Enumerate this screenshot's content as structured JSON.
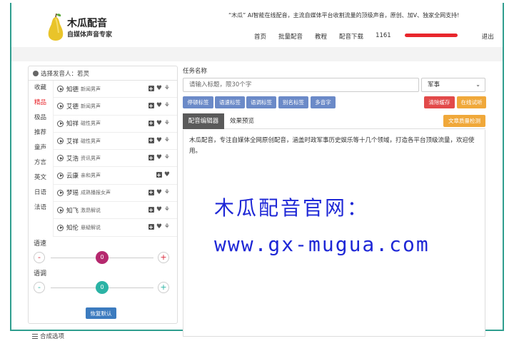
{
  "header": {
    "brand": "木瓜配音",
    "brand_sub": "自媒体声音专家",
    "slogan": "“木瓜” AI智能在线配音，主流自媒体平台收割流量的顶级声音，原创、加V、独家全网支持!",
    "nav": [
      "首页",
      "批量配音",
      "教程",
      "配音下载"
    ],
    "user_prefix": "1161",
    "logout": "退出"
  },
  "voice_panel": {
    "header": "选择发音人：若灵",
    "categories": [
      "收藏",
      "精品",
      "极品",
      "推荐",
      "童声",
      "方言",
      "英文",
      "日语",
      "法语"
    ],
    "active_category": "精品",
    "voices": [
      {
        "name": "知德",
        "desc": "新闻男声",
        "sprout": true
      },
      {
        "name": "艾德",
        "desc": "新闻男声",
        "sprout": true
      },
      {
        "name": "知祥",
        "desc": "磁性男声",
        "sprout": true
      },
      {
        "name": "艾祥",
        "desc": "磁性男声",
        "sprout": true
      },
      {
        "name": "艾浩",
        "desc": "资讯男声",
        "sprout": true
      },
      {
        "name": "云康",
        "desc": "亲和男声",
        "sprout": false
      },
      {
        "name": "梦瑶",
        "desc": "成熟播报女声",
        "sprout": true
      },
      {
        "name": "知飞",
        "desc": "激昂解说",
        "sprout": true
      },
      {
        "name": "知伦",
        "desc": "悬疑解说",
        "sprout": true
      }
    ],
    "speed": {
      "label": "语速",
      "minus": "-",
      "plus": "+",
      "value": "0",
      "color": "#b5286e"
    },
    "pitch": {
      "label": "语调",
      "minus": "-",
      "plus": "+",
      "value": "0",
      "color": "#2bb3a5"
    },
    "reset_label": "恢复默认",
    "combo_options": "合成选项"
  },
  "task": {
    "label": "任务名称",
    "title_placeholder": "请输入标题，限30个字",
    "genre": "军事"
  },
  "tag_buttons": [
    "停顿标签",
    "语速标签",
    "语调标签",
    "别名标签",
    "多音字"
  ],
  "actions": {
    "clear": "清除缓存",
    "listen": "在线试听",
    "quality": "文章质量检测"
  },
  "tabs": {
    "editor": "配音编辑器",
    "preview": "效果预览"
  },
  "editor": {
    "content": "木瓜配音，专注自媒体全网原创配音，涵盖时政军事历史娱乐等十几个领域，打造各平台顶级流量，欢迎使用。",
    "watermark_line1": "木瓜配音官网：",
    "watermark_line2": "www.gx-mugua.com"
  },
  "colors": {
    "tag_blue": "#6b8ac8",
    "clear_red": "#e24a4a",
    "listen_orange": "#f0a83a",
    "quality_orange": "#f0a83a",
    "reset_blue": "#3c7bbf",
    "active_tab": "#5a5a5a",
    "watermark": "#1e27d6",
    "frame_teal": "#2f9e8f"
  }
}
